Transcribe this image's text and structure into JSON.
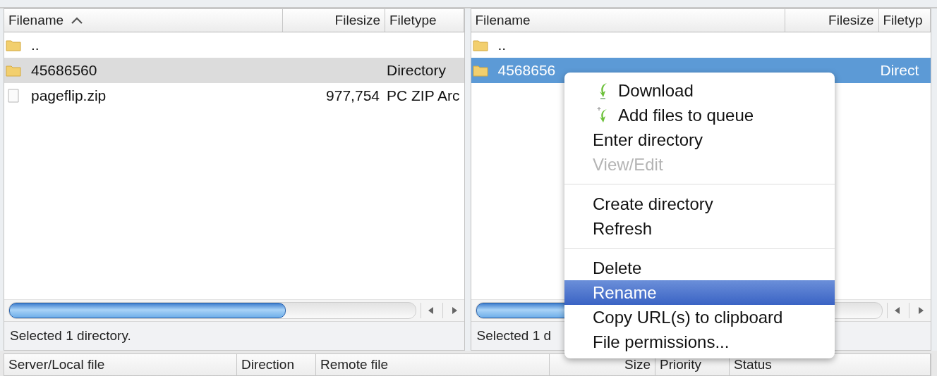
{
  "panes": [
    {
      "focused": false,
      "columns": [
        {
          "label": "Filename",
          "sorted": true
        },
        {
          "label": "Filesize",
          "sorted": false
        },
        {
          "label": "Filetype",
          "sorted": false
        }
      ],
      "rows": [
        {
          "kind": "folder",
          "name": "..",
          "selected": false
        },
        {
          "kind": "folder",
          "name": "45686560",
          "type": "Directory",
          "selected": true
        },
        {
          "kind": "file",
          "name": "pageflip.zip",
          "size": "977,754",
          "type": "PC ZIP Arc",
          "selected": false
        }
      ],
      "status": "Selected 1 directory."
    },
    {
      "focused": true,
      "columns": [
        {
          "label": "Filename",
          "sorted": false
        },
        {
          "label": "Filesize",
          "sorted": false
        },
        {
          "label": "Filetyp",
          "sorted": false
        }
      ],
      "rows": [
        {
          "kind": "folder",
          "name": "..",
          "selected": false
        },
        {
          "kind": "folder",
          "name": "4568656",
          "type": "Direct",
          "selected": true
        }
      ],
      "status": "Selected 1 d"
    }
  ],
  "queue": {
    "columns": [
      "Server/Local file",
      "Direction",
      "Remote file",
      "Size",
      "Priority",
      "Status"
    ]
  },
  "context_menu": {
    "groups": [
      [
        {
          "label": "Download",
          "kind": "download",
          "disabled": false,
          "selected": false
        },
        {
          "label": "Add files to queue",
          "kind": "queue",
          "disabled": false,
          "selected": false
        },
        {
          "label": "Enter directory",
          "disabled": false,
          "selected": false
        },
        {
          "label": "View/Edit",
          "disabled": true,
          "selected": false
        }
      ],
      [
        {
          "label": "Create directory",
          "disabled": false,
          "selected": false
        },
        {
          "label": "Refresh",
          "disabled": false,
          "selected": false
        }
      ],
      [
        {
          "label": "Delete",
          "disabled": false,
          "selected": false
        },
        {
          "label": "Rename",
          "disabled": false,
          "selected": true
        },
        {
          "label": "Copy URL(s) to clipboard",
          "disabled": false,
          "selected": false
        },
        {
          "label": "File permissions...",
          "disabled": false,
          "selected": false
        }
      ]
    ]
  }
}
